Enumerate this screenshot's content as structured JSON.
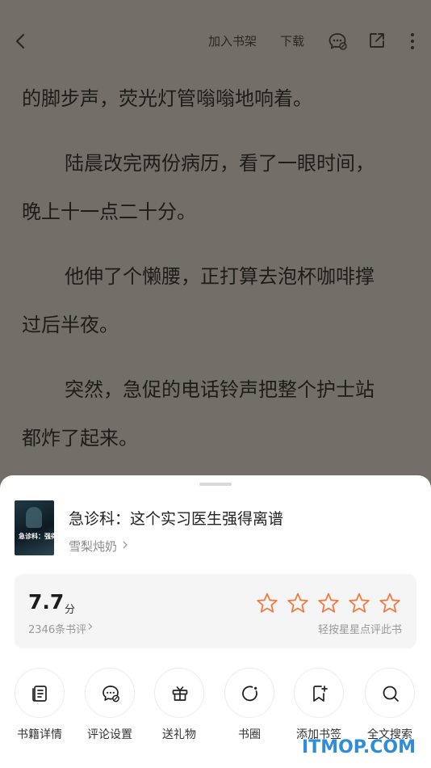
{
  "header": {
    "add_to_shelf": "加入书架",
    "download": "下载"
  },
  "paragraphs": [
    "的脚步声，荧光灯管嗡嗡地响着。",
    "陆晨改完两份病历，看了一眼时间，",
    "晚上十一点二十分。",
    "他伸了个懒腰，正打算去泡杯咖啡撑",
    "过后半夜。",
    "突然，急促的电话铃声把整个护士站",
    "都炸了起来。"
  ],
  "book": {
    "title": "急诊科：这个实习医生强得离谱",
    "author": "雪梨炖奶",
    "cover_text": "急诊科：强得离谱"
  },
  "rating": {
    "score": "7.7",
    "unit": "分",
    "review_count": "2346条书评",
    "stars_total": 5,
    "stars_selected": 0,
    "hint": "轻按星星点评此书",
    "star_color": "#f07a43"
  },
  "actions": [
    {
      "label": "书籍详情",
      "icon": "book-detail-icon"
    },
    {
      "label": "评论设置",
      "icon": "comment-settings-icon"
    },
    {
      "label": "送礼物",
      "icon": "gift-icon"
    },
    {
      "label": "书圈",
      "icon": "book-circle-icon"
    },
    {
      "label": "添加书签",
      "icon": "bookmark-add-icon"
    },
    {
      "label": "全文搜索",
      "icon": "search-icon"
    }
  ],
  "watermark": "ITMOP.COM"
}
